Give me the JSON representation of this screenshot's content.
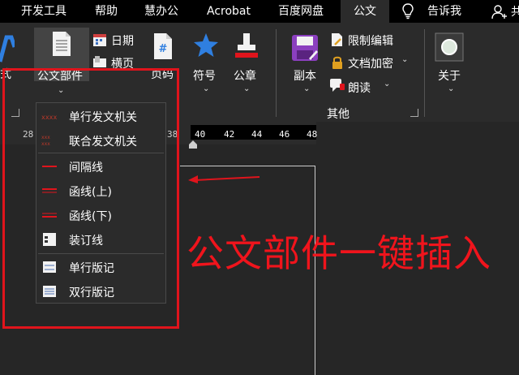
{
  "menu_tabs": [
    {
      "label": "开发工具"
    },
    {
      "label": "帮助"
    },
    {
      "label": "慧办公"
    },
    {
      "label": "Acrobat"
    },
    {
      "label": "百度网盘"
    },
    {
      "label": "公文"
    },
    {
      "label": "告诉我"
    }
  ],
  "ribbon": {
    "partial_left_label": "式",
    "gongwen_bujian": "公文部件",
    "date": "日期",
    "landscape": "横页",
    "page_number": "页码",
    "symbol": "符号",
    "seal": "公章",
    "copy": "副本",
    "restrict_edit": "限制编辑",
    "doc_encrypt": "文档加密",
    "read_aloud": "朗读",
    "about": "关于",
    "group_other": "其他"
  },
  "ruler_ticks": [
    "28",
    "38",
    "40",
    "42",
    "44",
    "46",
    "48"
  ],
  "dropdown": {
    "items": [
      {
        "label": "单行发文机关",
        "icon": "single-issuer-icon"
      },
      {
        "label": "联合发文机关",
        "icon": "joint-issuer-icon"
      },
      {
        "label": "间隔线",
        "icon": "separator-line-icon"
      },
      {
        "label": "函线(上)",
        "icon": "letter-line-top-icon"
      },
      {
        "label": "函线(下)",
        "icon": "letter-line-bottom-icon"
      },
      {
        "label": "装订线",
        "icon": "binding-line-icon"
      },
      {
        "label": "单行版记",
        "icon": "single-footer-record-icon"
      },
      {
        "label": "双行版记",
        "icon": "double-footer-record-icon"
      }
    ]
  },
  "annotation": {
    "text": "公文部件一键插入",
    "color": "#f0141c"
  },
  "colors": {
    "menubar_bg": "#000000",
    "ribbon_bg": "#2b2b2b",
    "accent_red": "#e0141c",
    "symbol_blue": "#2f7fe0",
    "lock_gold": "#e0a020"
  }
}
